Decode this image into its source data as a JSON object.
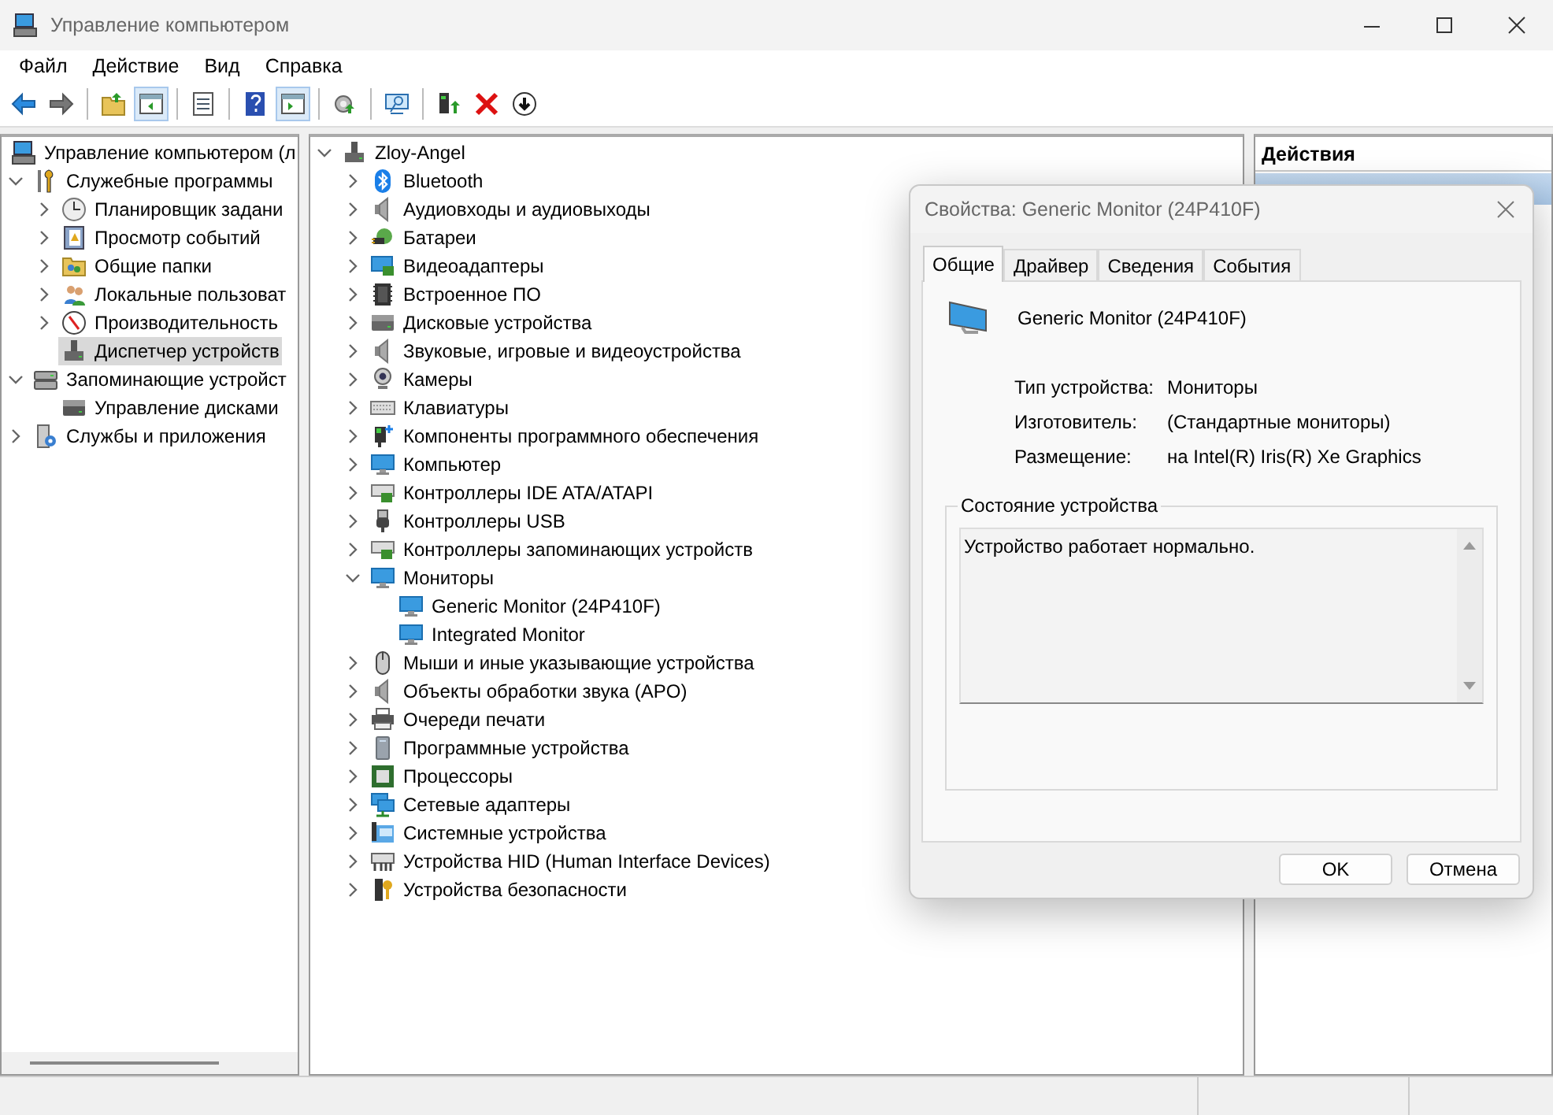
{
  "window": {
    "title": "Управление компьютером"
  },
  "menu": [
    "Файл",
    "Действие",
    "Вид",
    "Справка"
  ],
  "toolbar": [
    {
      "kind": "button",
      "pressed": false
    },
    {
      "kind": "button",
      "pressed": false
    },
    {
      "kind": "separator"
    },
    {
      "kind": "button",
      "pressed": false
    },
    {
      "kind": "button",
      "pressed": true
    },
    {
      "kind": "separator"
    },
    {
      "kind": "button",
      "pressed": false
    },
    {
      "kind": "separator"
    },
    {
      "kind": "button",
      "pressed": false
    },
    {
      "kind": "button",
      "pressed": true
    },
    {
      "kind": "separator"
    },
    {
      "kind": "button",
      "pressed": false
    },
    {
      "kind": "separator"
    },
    {
      "kind": "button",
      "pressed": false
    },
    {
      "kind": "separator"
    },
    {
      "kind": "button",
      "pressed": false
    },
    {
      "kind": "button",
      "pressed": false
    },
    {
      "kind": "button",
      "pressed": false
    }
  ],
  "console_tree": {
    "label": "Управление компьютером (л",
    "children": [
      {
        "label": "Служебные программы",
        "expanded": true,
        "selected": false,
        "children": [
          {
            "label": "Планировщик задани",
            "expanded": false,
            "selected": false
          },
          {
            "label": "Просмотр событий",
            "expanded": false,
            "selected": false
          },
          {
            "label": "Общие папки",
            "expanded": false,
            "selected": false
          },
          {
            "label": "Локальные пользоват",
            "expanded": false,
            "selected": false
          },
          {
            "label": "Производительность",
            "expanded": false,
            "selected": false
          },
          {
            "label": "Диспетчер устройств",
            "selected": true
          }
        ]
      },
      {
        "label": "Запоминающие устройст",
        "expanded": true,
        "selected": false,
        "children": [
          {
            "label": "Управление дисками",
            "selected": false
          }
        ]
      },
      {
        "label": "Службы и приложения",
        "expanded": false,
        "selected": false
      }
    ]
  },
  "device_tree": {
    "label": "Zloy-Angel",
    "expanded": true,
    "children": [
      {
        "label": "Bluetooth",
        "expanded": false
      },
      {
        "label": "Аудиовходы и аудиовыходы",
        "expanded": false
      },
      {
        "label": "Батареи",
        "expanded": false
      },
      {
        "label": "Видеоадаптеры",
        "expanded": false
      },
      {
        "label": "Встроенное ПО",
        "expanded": false
      },
      {
        "label": "Дисковые устройства",
        "expanded": false
      },
      {
        "label": "Звуковые, игровые и видеоустройства",
        "expanded": false
      },
      {
        "label": "Камеры",
        "expanded": false
      },
      {
        "label": "Клавиатуры",
        "expanded": false
      },
      {
        "label": "Компоненты программного обеспечения",
        "expanded": false
      },
      {
        "label": "Компьютер",
        "expanded": false
      },
      {
        "label": "Контроллеры IDE ATA/ATAPI",
        "expanded": false
      },
      {
        "label": "Контроллеры USB",
        "expanded": false
      },
      {
        "label": "Контроллеры запоминающих устройств",
        "expanded": false
      },
      {
        "label": "Мониторы",
        "expanded": true,
        "children": [
          {
            "label": "Generic Monitor (24P410F)"
          },
          {
            "label": "Integrated Monitor"
          }
        ]
      },
      {
        "label": "Мыши и иные указывающие устройства",
        "expanded": false
      },
      {
        "label": "Объекты обработки звука (APO)",
        "expanded": false
      },
      {
        "label": "Очереди печати",
        "expanded": false
      },
      {
        "label": "Программные устройства",
        "expanded": false
      },
      {
        "label": "Процессоры",
        "expanded": false
      },
      {
        "label": "Сетевые адаптеры",
        "expanded": false
      },
      {
        "label": "Системные устройства",
        "expanded": false
      },
      {
        "label": "Устройства HID (Human Interface Devices)",
        "expanded": false
      },
      {
        "label": "Устройства безопасности",
        "expanded": false
      }
    ]
  },
  "actions_pane": {
    "title": "Действия"
  },
  "dialog": {
    "title": "Свойства: Generic Monitor (24P410F)",
    "tabs": [
      {
        "label": "Общие",
        "selected": true
      },
      {
        "label": "Драйвер",
        "selected": false
      },
      {
        "label": "Сведения",
        "selected": false
      },
      {
        "label": "События",
        "selected": false
      }
    ],
    "device_name": "Generic Monitor (24P410F)",
    "properties": [
      {
        "label": "Тип устройства:",
        "value": "Мониторы"
      },
      {
        "label": "Изготовитель:",
        "value": "(Стандартные мониторы)"
      },
      {
        "label": "Размещение:",
        "value": "на Intel(R) Iris(R) Xe Graphics"
      }
    ],
    "status_group": {
      "title": "Состояние устройства",
      "text": "Устройство работает нормально."
    },
    "buttons": [
      "OK",
      "Отмена"
    ]
  }
}
